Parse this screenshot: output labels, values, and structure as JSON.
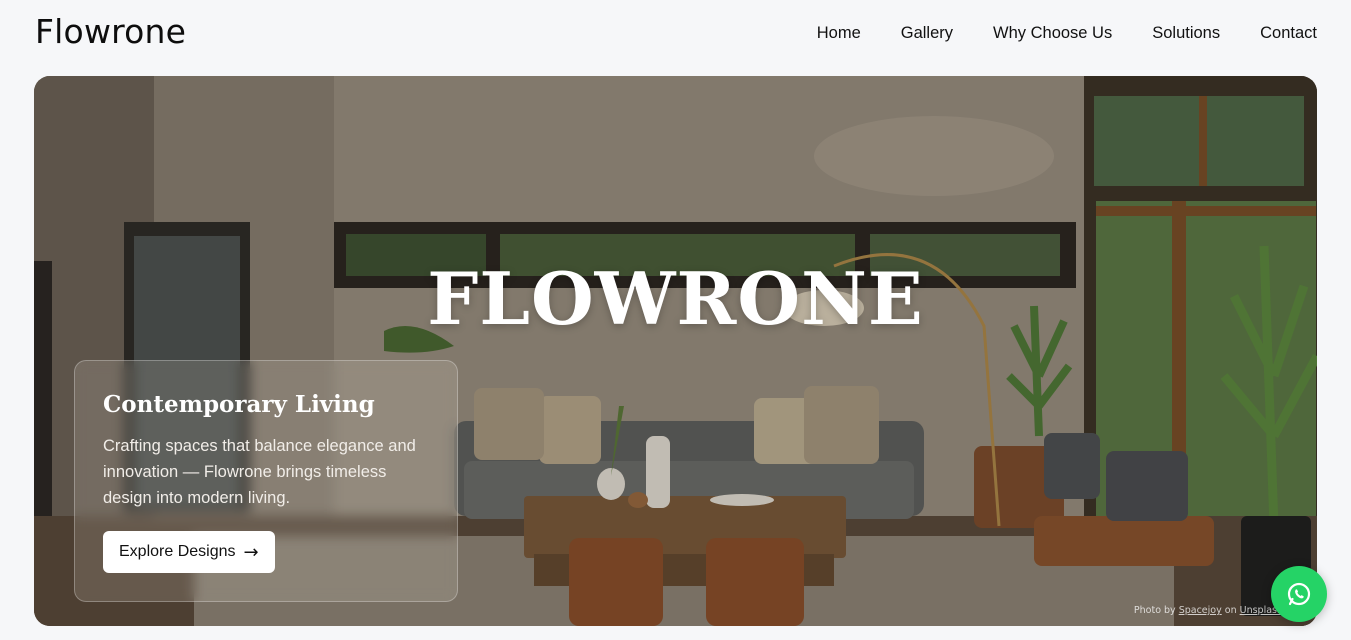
{
  "brand": {
    "logo": "Flowrone"
  },
  "nav": {
    "items": [
      "Home",
      "Gallery",
      "Why Choose Us",
      "Solutions",
      "Contact"
    ]
  },
  "hero": {
    "title": "FLOWRONE",
    "card": {
      "heading": "Contemporary Living",
      "text": "Crafting spaces that balance elegance and innovation — Flowrone brings timeless design into modern living.",
      "button_label": "Explore Designs",
      "button_arrow": "→"
    },
    "credit": {
      "prefix": "Photo by ",
      "author": "Spacejoy",
      "middle": " on ",
      "site": "Unsplash"
    }
  },
  "colors": {
    "whatsapp": "#25d366",
    "page_bg": "#f6f7f9"
  },
  "icons": {
    "whatsapp": "whatsapp-icon"
  }
}
